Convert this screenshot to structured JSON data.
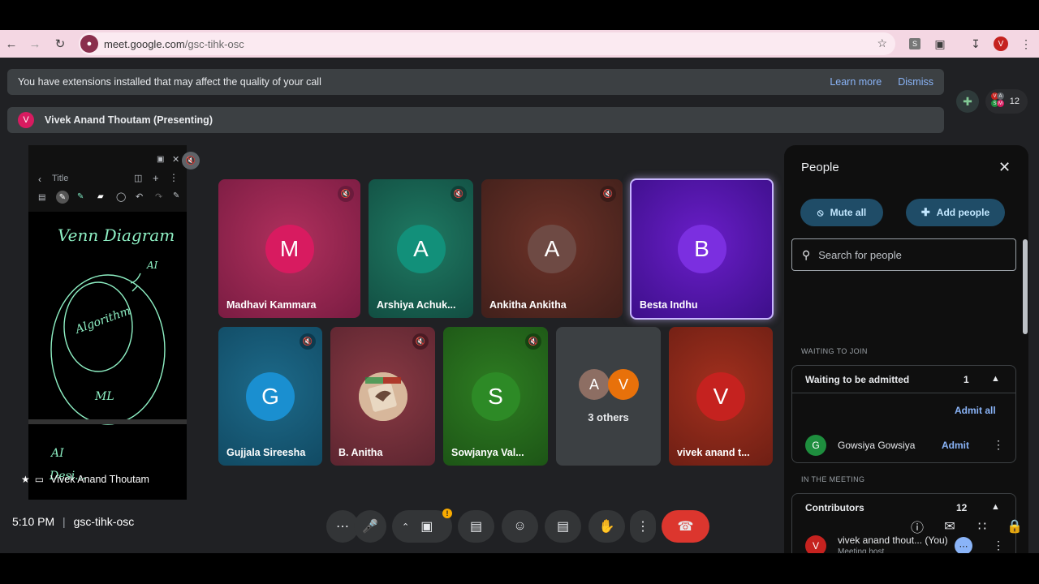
{
  "browser": {
    "url_host": "meet.google.com",
    "url_path": "/gsc-tihk-osc",
    "profile_initial": "V"
  },
  "banner": {
    "message": "You have extensions installed that may affect the quality of your call",
    "learn_more": "Learn more",
    "dismiss": "Dismiss"
  },
  "presenting": {
    "initial": "V",
    "label": "Vivek Anand Thoutam (Presenting)"
  },
  "participants_count": "12",
  "presentation": {
    "doc_title": "Title",
    "presenter_name": "Vivek Anand Thoutam",
    "handwriting": [
      "Venn Diagram",
      "AI",
      "Algorithm",
      "ML",
      "AI",
      "Desi..."
    ]
  },
  "tiles": [
    {
      "initial": "M",
      "name": "Madhavi Kammara",
      "muted": true
    },
    {
      "initial": "A",
      "name": "Arshiya Achuk...",
      "muted": true
    },
    {
      "initial": "A",
      "name": "Ankitha Ankitha",
      "muted": true
    },
    {
      "initial": "B",
      "name": "Besta Indhu",
      "muted": false
    },
    {
      "initial": "G",
      "name": "Gujjala Sireesha",
      "muted": true
    },
    {
      "initial": "",
      "name": "B. Anitha",
      "muted": true
    },
    {
      "initial": "S",
      "name": "Sowjanya Val...",
      "muted": true
    },
    {
      "initial": "",
      "name": "3 others",
      "avatars": [
        "A",
        "V"
      ]
    },
    {
      "initial": "V",
      "name": "vivek anand t...",
      "muted": false
    }
  ],
  "people_panel": {
    "title": "People",
    "mute_all": "Mute all",
    "add_people": "Add people",
    "search_placeholder": "Search for people",
    "waiting_section": "WAITING TO JOIN",
    "waiting_header": "Waiting to be admitted",
    "waiting_count": "1",
    "admit_all": "Admit all",
    "waiting_person": {
      "initial": "G",
      "name": "Gowsiya Gowsiya",
      "admit": "Admit"
    },
    "meeting_section": "IN THE MEETING",
    "contributors_header": "Contributors",
    "contributors_count": "12",
    "host": {
      "initial": "V",
      "name": "vivek anand thout...",
      "you": "(You)",
      "role": "Meeting host"
    }
  },
  "bottom_bar": {
    "time": "5:10 PM",
    "meeting_code": "gsc-tihk-osc"
  },
  "colors": {
    "accent_blue": "#8ab4f8",
    "pill_bg": "#1f4c67",
    "end_call": "#dc362e",
    "green_icon": "#81c995"
  }
}
